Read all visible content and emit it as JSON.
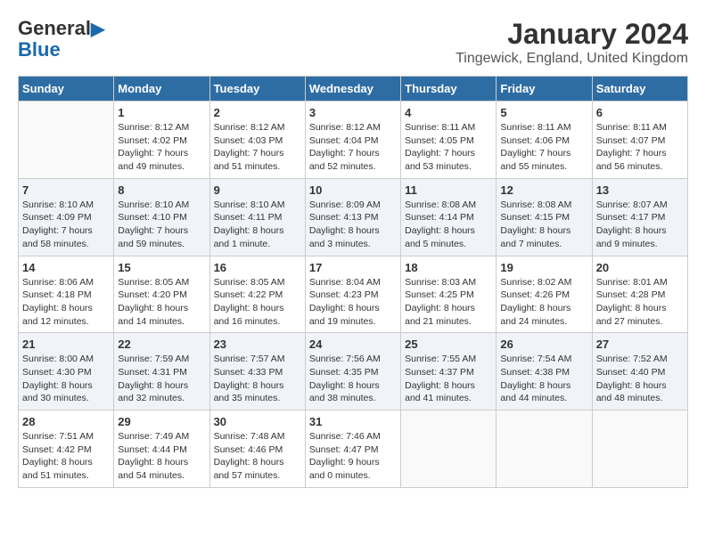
{
  "header": {
    "logo_line1": "General",
    "logo_line2": "Blue",
    "title": "January 2024",
    "subtitle": "Tingewick, England, United Kingdom"
  },
  "days_of_week": [
    "Sunday",
    "Monday",
    "Tuesday",
    "Wednesday",
    "Thursday",
    "Friday",
    "Saturday"
  ],
  "weeks": [
    [
      {
        "day": "",
        "sunrise": "",
        "sunset": "",
        "daylight": ""
      },
      {
        "day": "1",
        "sunrise": "Sunrise: 8:12 AM",
        "sunset": "Sunset: 4:02 PM",
        "daylight": "Daylight: 7 hours and 49 minutes."
      },
      {
        "day": "2",
        "sunrise": "Sunrise: 8:12 AM",
        "sunset": "Sunset: 4:03 PM",
        "daylight": "Daylight: 7 hours and 51 minutes."
      },
      {
        "day": "3",
        "sunrise": "Sunrise: 8:12 AM",
        "sunset": "Sunset: 4:04 PM",
        "daylight": "Daylight: 7 hours and 52 minutes."
      },
      {
        "day": "4",
        "sunrise": "Sunrise: 8:11 AM",
        "sunset": "Sunset: 4:05 PM",
        "daylight": "Daylight: 7 hours and 53 minutes."
      },
      {
        "day": "5",
        "sunrise": "Sunrise: 8:11 AM",
        "sunset": "Sunset: 4:06 PM",
        "daylight": "Daylight: 7 hours and 55 minutes."
      },
      {
        "day": "6",
        "sunrise": "Sunrise: 8:11 AM",
        "sunset": "Sunset: 4:07 PM",
        "daylight": "Daylight: 7 hours and 56 minutes."
      }
    ],
    [
      {
        "day": "7",
        "sunrise": "Sunrise: 8:10 AM",
        "sunset": "Sunset: 4:09 PM",
        "daylight": "Daylight: 7 hours and 58 minutes."
      },
      {
        "day": "8",
        "sunrise": "Sunrise: 8:10 AM",
        "sunset": "Sunset: 4:10 PM",
        "daylight": "Daylight: 7 hours and 59 minutes."
      },
      {
        "day": "9",
        "sunrise": "Sunrise: 8:10 AM",
        "sunset": "Sunset: 4:11 PM",
        "daylight": "Daylight: 8 hours and 1 minute."
      },
      {
        "day": "10",
        "sunrise": "Sunrise: 8:09 AM",
        "sunset": "Sunset: 4:13 PM",
        "daylight": "Daylight: 8 hours and 3 minutes."
      },
      {
        "day": "11",
        "sunrise": "Sunrise: 8:08 AM",
        "sunset": "Sunset: 4:14 PM",
        "daylight": "Daylight: 8 hours and 5 minutes."
      },
      {
        "day": "12",
        "sunrise": "Sunrise: 8:08 AM",
        "sunset": "Sunset: 4:15 PM",
        "daylight": "Daylight: 8 hours and 7 minutes."
      },
      {
        "day": "13",
        "sunrise": "Sunrise: 8:07 AM",
        "sunset": "Sunset: 4:17 PM",
        "daylight": "Daylight: 8 hours and 9 minutes."
      }
    ],
    [
      {
        "day": "14",
        "sunrise": "Sunrise: 8:06 AM",
        "sunset": "Sunset: 4:18 PM",
        "daylight": "Daylight: 8 hours and 12 minutes."
      },
      {
        "day": "15",
        "sunrise": "Sunrise: 8:05 AM",
        "sunset": "Sunset: 4:20 PM",
        "daylight": "Daylight: 8 hours and 14 minutes."
      },
      {
        "day": "16",
        "sunrise": "Sunrise: 8:05 AM",
        "sunset": "Sunset: 4:22 PM",
        "daylight": "Daylight: 8 hours and 16 minutes."
      },
      {
        "day": "17",
        "sunrise": "Sunrise: 8:04 AM",
        "sunset": "Sunset: 4:23 PM",
        "daylight": "Daylight: 8 hours and 19 minutes."
      },
      {
        "day": "18",
        "sunrise": "Sunrise: 8:03 AM",
        "sunset": "Sunset: 4:25 PM",
        "daylight": "Daylight: 8 hours and 21 minutes."
      },
      {
        "day": "19",
        "sunrise": "Sunrise: 8:02 AM",
        "sunset": "Sunset: 4:26 PM",
        "daylight": "Daylight: 8 hours and 24 minutes."
      },
      {
        "day": "20",
        "sunrise": "Sunrise: 8:01 AM",
        "sunset": "Sunset: 4:28 PM",
        "daylight": "Daylight: 8 hours and 27 minutes."
      }
    ],
    [
      {
        "day": "21",
        "sunrise": "Sunrise: 8:00 AM",
        "sunset": "Sunset: 4:30 PM",
        "daylight": "Daylight: 8 hours and 30 minutes."
      },
      {
        "day": "22",
        "sunrise": "Sunrise: 7:59 AM",
        "sunset": "Sunset: 4:31 PM",
        "daylight": "Daylight: 8 hours and 32 minutes."
      },
      {
        "day": "23",
        "sunrise": "Sunrise: 7:57 AM",
        "sunset": "Sunset: 4:33 PM",
        "daylight": "Daylight: 8 hours and 35 minutes."
      },
      {
        "day": "24",
        "sunrise": "Sunrise: 7:56 AM",
        "sunset": "Sunset: 4:35 PM",
        "daylight": "Daylight: 8 hours and 38 minutes."
      },
      {
        "day": "25",
        "sunrise": "Sunrise: 7:55 AM",
        "sunset": "Sunset: 4:37 PM",
        "daylight": "Daylight: 8 hours and 41 minutes."
      },
      {
        "day": "26",
        "sunrise": "Sunrise: 7:54 AM",
        "sunset": "Sunset: 4:38 PM",
        "daylight": "Daylight: 8 hours and 44 minutes."
      },
      {
        "day": "27",
        "sunrise": "Sunrise: 7:52 AM",
        "sunset": "Sunset: 4:40 PM",
        "daylight": "Daylight: 8 hours and 48 minutes."
      }
    ],
    [
      {
        "day": "28",
        "sunrise": "Sunrise: 7:51 AM",
        "sunset": "Sunset: 4:42 PM",
        "daylight": "Daylight: 8 hours and 51 minutes."
      },
      {
        "day": "29",
        "sunrise": "Sunrise: 7:49 AM",
        "sunset": "Sunset: 4:44 PM",
        "daylight": "Daylight: 8 hours and 54 minutes."
      },
      {
        "day": "30",
        "sunrise": "Sunrise: 7:48 AM",
        "sunset": "Sunset: 4:46 PM",
        "daylight": "Daylight: 8 hours and 57 minutes."
      },
      {
        "day": "31",
        "sunrise": "Sunrise: 7:46 AM",
        "sunset": "Sunset: 4:47 PM",
        "daylight": "Daylight: 9 hours and 0 minutes."
      },
      {
        "day": "",
        "sunrise": "",
        "sunset": "",
        "daylight": ""
      },
      {
        "day": "",
        "sunrise": "",
        "sunset": "",
        "daylight": ""
      },
      {
        "day": "",
        "sunrise": "",
        "sunset": "",
        "daylight": ""
      }
    ]
  ]
}
